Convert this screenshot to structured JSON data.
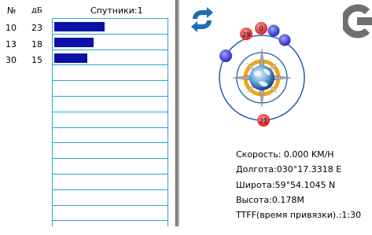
{
  "satellite_panel": {
    "col_no_label": "№",
    "col_db_label": "дБ",
    "satellites_label": "Спутники:1",
    "rows": [
      {
        "id": "10",
        "snr": "23",
        "signal": 23
      },
      {
        "id": "13",
        "snr": "18",
        "signal": 18
      },
      {
        "id": "30",
        "snr": "15",
        "signal": 15
      }
    ],
    "bar_color": "#0a10a8",
    "grid_color": "#2aa3dc"
  },
  "sky_view": {
    "satellites": [
      {
        "id": "0",
        "color": "#e01010"
      },
      {
        "id": "29",
        "color": "#e01010"
      },
      {
        "id": "21",
        "color": "#e01010"
      }
    ],
    "blue_satellite_color": "#1a1ad0"
  },
  "refresh_icon": "refresh-icon",
  "info": {
    "speed": "Скорость: 0.000 KM/H",
    "longitude": "Долгота:030°17.3318 E",
    "latitude": "Широта:59°54.1045 N",
    "altitude": "Высота:0.178M",
    "ttff": "TTFF(время привязки).:1:30"
  }
}
